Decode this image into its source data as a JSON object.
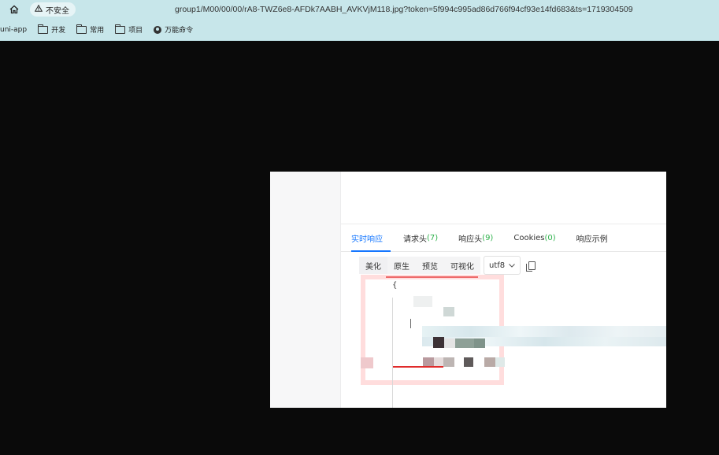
{
  "browser": {
    "home_icon": "home-icon",
    "security_label": "不安全",
    "url": "group1/M00/00/00/rA8-TWZ6e8-AFDk7AABH_AVKVjM118.jpg?token=5f994c995ad86d766f94cf93e14fd683&ts=1719304509"
  },
  "bookmarks": [
    {
      "label": "uni-app",
      "icon": "none"
    },
    {
      "label": "开发",
      "icon": "folder-icon"
    },
    {
      "label": "常用",
      "icon": "folder-icon"
    },
    {
      "label": "项目",
      "icon": "folder-icon"
    },
    {
      "label": "万能命令",
      "icon": "globe-icon"
    }
  ],
  "response_tabs": [
    {
      "label": "实时响应",
      "count": "",
      "active": true
    },
    {
      "label": "请求头",
      "count": "(7)",
      "active": false
    },
    {
      "label": "响应头",
      "count": "(9)",
      "active": false
    },
    {
      "label": "Cookies",
      "count": "(0)",
      "active": false
    },
    {
      "label": "响应示例",
      "count": "",
      "active": false
    }
  ],
  "view_modes": [
    "美化",
    "原生",
    "预览",
    "可视化"
  ],
  "encoding": "utf8",
  "code_open_brace": "{",
  "colors": {
    "chrome_bg": "#c7e6ea",
    "active_tab": "#1677ff",
    "count_green": "#2fb24c",
    "annotation_red": "#e02b2b"
  }
}
